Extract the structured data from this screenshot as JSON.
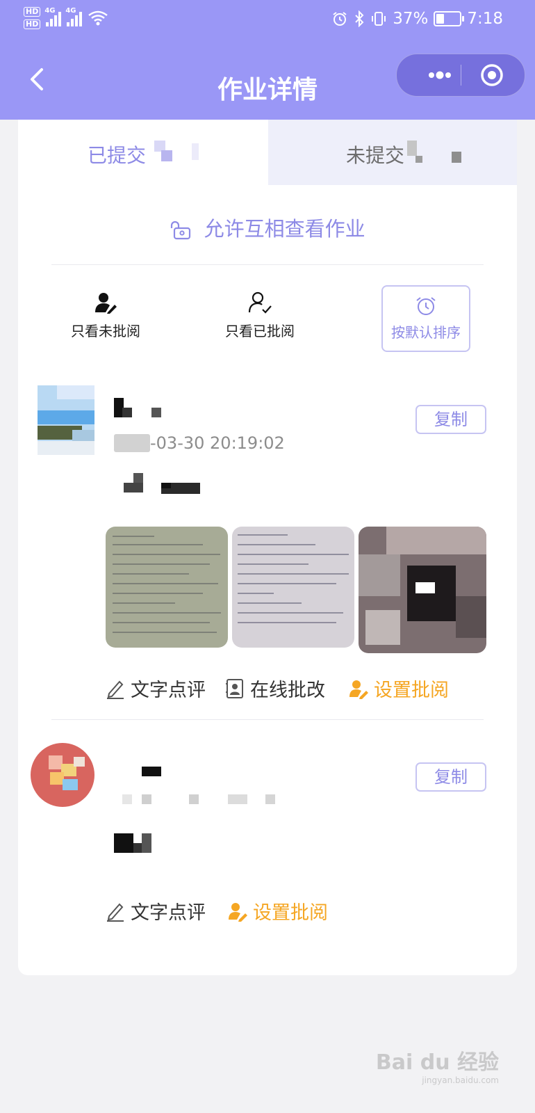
{
  "status_bar": {
    "left_badges": [
      "HD",
      "HD"
    ],
    "network_labels": [
      "4G",
      "4G"
    ],
    "battery_percent": "37%",
    "time": "7:18",
    "icons": [
      "alarm-icon",
      "bluetooth-icon",
      "vibrate-icon",
      "battery-icon",
      "wifi-icon"
    ]
  },
  "nav": {
    "title": "作业详情",
    "back_icon": "chevron-left-icon",
    "menu_icon": "more-dots-icon",
    "close_icon": "target-icon"
  },
  "tabs": [
    {
      "label": "已提交",
      "active": true
    },
    {
      "label": "未提交",
      "active": false
    }
  ],
  "permission_text": "允许互相查看作业",
  "filters": {
    "unreviewed": "只看未批阅",
    "reviewed": "只看已批阅",
    "sort": "按默认排序"
  },
  "submissions": [
    {
      "time": "-03-30 20:19:02",
      "copy_label": "复制",
      "actions": [
        "文字点评",
        "在线批改",
        "设置批阅"
      ],
      "image_count": 3
    },
    {
      "time": "",
      "copy_label": "复制",
      "actions": [
        "文字点评",
        "设置批阅"
      ],
      "image_count": 0
    }
  ],
  "colors": {
    "header": "#9a97f6",
    "accent": "#8d8ae6",
    "orange": "#f5a623"
  },
  "watermark": {
    "text": "Bai du 经验",
    "sub": "jingyan.baidu.com"
  }
}
